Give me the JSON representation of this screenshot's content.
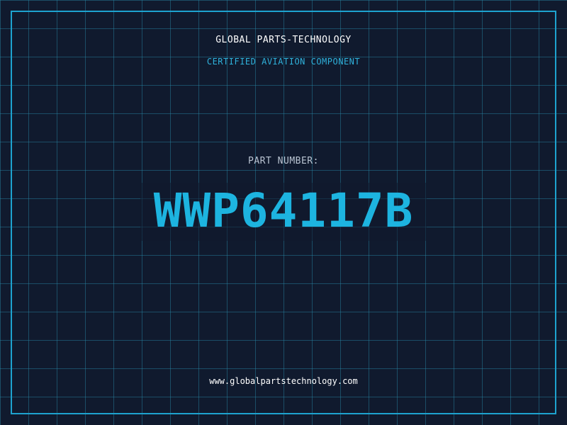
{
  "header": {
    "brand": "GLOBAL PARTS-TECHNOLOGY",
    "subtitle": "CERTIFIED AVIATION COMPONENT"
  },
  "main": {
    "label": "PART NUMBER:",
    "part_number": "WWP64117B"
  },
  "footer": {
    "url": "www.globalpartstechnology.com"
  },
  "colors": {
    "background": "#101a2e",
    "grid": "#1e6f87",
    "accent": "#1db4e0",
    "frame": "#1ea3cf",
    "text": "#ffffff",
    "muted": "#b9c4d2"
  }
}
